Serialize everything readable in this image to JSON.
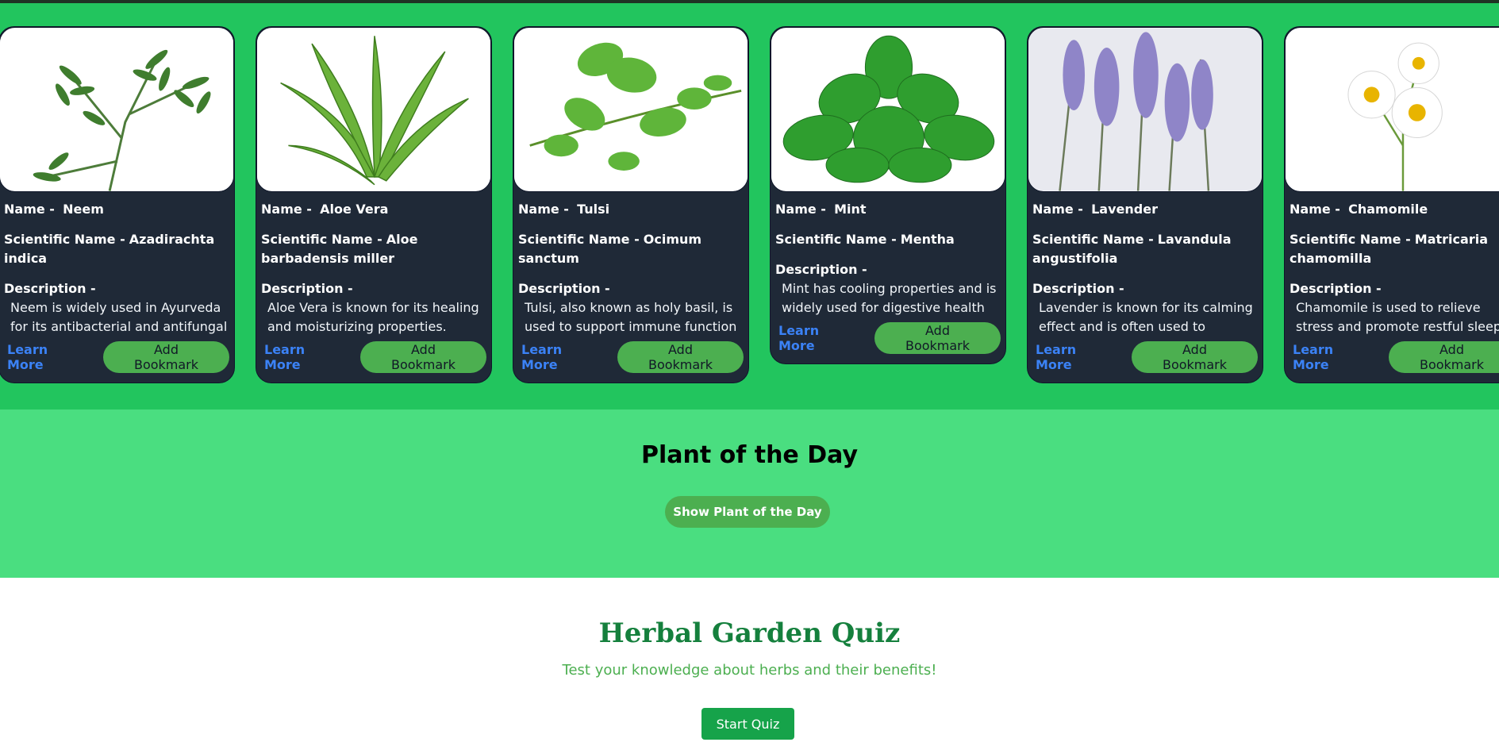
{
  "plants": [
    {
      "name_label": "Name -",
      "name": "Neem",
      "sci_label": "Scientific Name -",
      "sci": "Azadirachta indica",
      "desc_label": "Description -",
      "desc": "Neem is widely used in Ayurveda for its antibacterial and antifungal",
      "learn_more": "Learn More",
      "bookmark": "Add Bookmark",
      "image": "neem-leaf"
    },
    {
      "name_label": "Name -",
      "name": "Aloe Vera",
      "sci_label": "Scientific Name -",
      "sci": "Aloe barbadensis miller",
      "desc_label": "Description -",
      "desc": "Aloe Vera is known for its healing and moisturizing properties.",
      "learn_more": "Learn More",
      "bookmark": "Add Bookmark",
      "image": "aloe-vera"
    },
    {
      "name_label": "Name -",
      "name": "Tulsi",
      "sci_label": "Scientific Name -",
      "sci": "Ocimum sanctum",
      "desc_label": "Description -",
      "desc": "Tulsi, also known as holy basil, is used to support immune function and",
      "learn_more": "Learn More",
      "bookmark": "Add Bookmark",
      "image": "tulsi-sprig"
    },
    {
      "name_label": "Name -",
      "name": "Mint",
      "sci_label": "Scientific Name -",
      "sci": "Mentha",
      "desc_label": "Description -",
      "desc": "Mint has cooling properties and is widely used for digestive health and",
      "learn_more": "Learn More",
      "bookmark": "Add Bookmark",
      "image": "mint-leaves"
    },
    {
      "name_label": "Name -",
      "name": "Lavender",
      "sci_label": "Scientific Name -",
      "sci": "Lavandula angustifolia",
      "desc_label": "Description -",
      "desc": "Lavender is known for its calming effect and is often used to promote",
      "learn_more": "Learn More",
      "bookmark": "Add Bookmark",
      "image": "lavender-flowers"
    },
    {
      "name_label": "Name -",
      "name": "Chamomile",
      "sci_label": "Scientific Name -",
      "sci": "Matricaria chamomilla",
      "desc_label": "Description -",
      "desc": "Chamomile is used to relieve stress and promote restful sleep, as well as",
      "learn_more": "Learn More",
      "bookmark": "Add Bookmark",
      "image": "chamomile-flowers"
    }
  ],
  "plant_of_day": {
    "title": "Plant of the Day",
    "button": "Show Plant of the Day"
  },
  "quiz": {
    "title": "Herbal Garden Quiz",
    "subtitle": "Test your knowledge about herbs and their benefits!",
    "button": "Start Quiz"
  },
  "colors": {
    "cards_bg": "#22c55e",
    "card_bg": "#1f2937",
    "potd_bg": "#4ade80",
    "button_green": "#4caf50",
    "link_blue": "#3b82f6",
    "quiz_title": "#15803d"
  }
}
